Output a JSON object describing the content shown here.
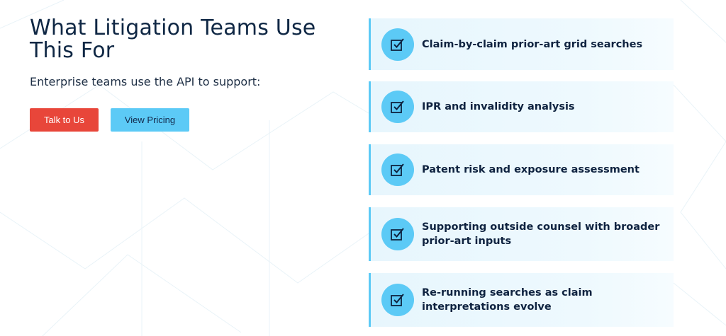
{
  "heading": "What Litigation Teams Use This For",
  "subheading": "Enterprise teams use the API to support:",
  "buttons": {
    "talk": "Talk to Us",
    "pricing": "View Pricing"
  },
  "use_cases": [
    "Claim-by-claim prior-art grid searches",
    "IPR and invalidity analysis",
    "Patent risk and exposure assessment",
    "Supporting outside counsel with broader prior-art inputs",
    "Re-running searches as claim interpretations evolve"
  ],
  "icons": {
    "item": "checkbox-check-icon"
  },
  "colors": {
    "accent": "#5ccaf6",
    "cta": "#e8463a",
    "heading": "#0f2744",
    "card_bg": "#e7f6fd"
  }
}
